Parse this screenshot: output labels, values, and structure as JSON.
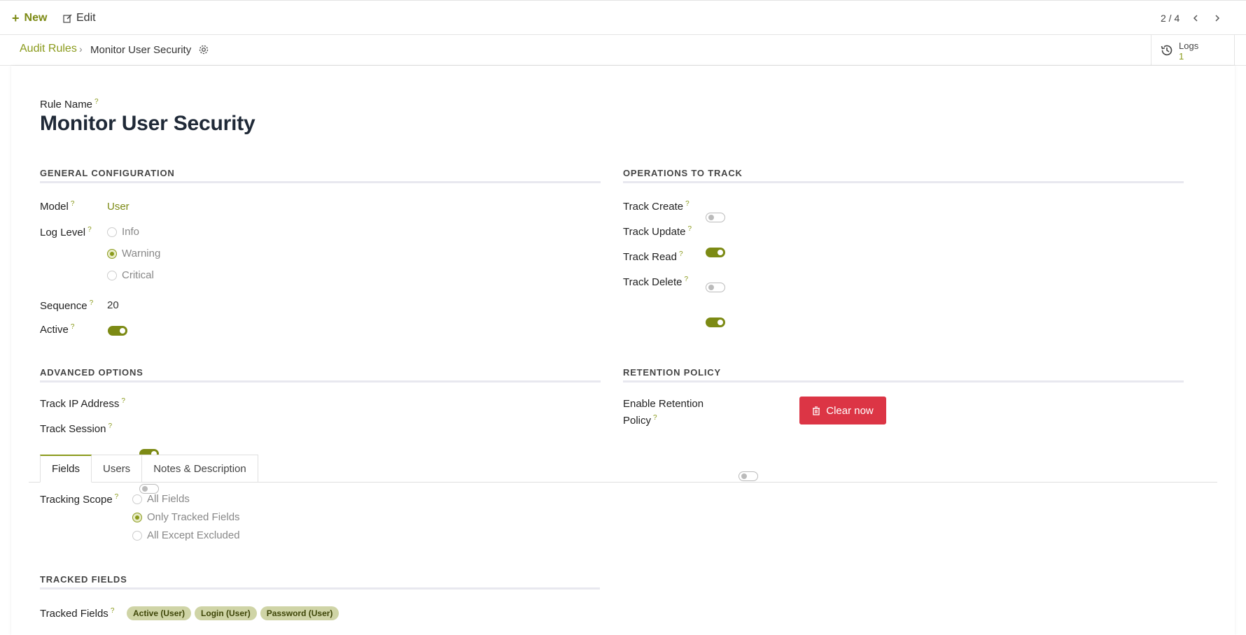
{
  "toolbar": {
    "new_label": "New",
    "edit_label": "Edit",
    "pager": "2 / 4"
  },
  "breadcrumb": {
    "parent": "Audit Rules",
    "current": "Monitor User Security"
  },
  "logs": {
    "label": "Logs",
    "count": "1"
  },
  "form": {
    "rule_name_label": "Rule Name",
    "rule_name": "Monitor User Security",
    "general": {
      "title": "GENERAL CONFIGURATION",
      "model_label": "Model",
      "model_value": "User",
      "log_level_label": "Log Level",
      "log_levels": [
        "Info",
        "Warning",
        "Critical"
      ],
      "log_level_selected": "Warning",
      "sequence_label": "Sequence",
      "sequence_value": "20",
      "active_label": "Active",
      "active": true
    },
    "operations": {
      "title": "OPERATIONS TO TRACK",
      "items": [
        {
          "label": "Track Create",
          "on": false
        },
        {
          "label": "Track Update",
          "on": true
        },
        {
          "label": "Track Read",
          "on": false
        },
        {
          "label": "Track Delete",
          "on": true
        }
      ]
    },
    "advanced": {
      "title": "ADVANCED OPTIONS",
      "items": [
        {
          "label": "Track IP Address",
          "on": true
        },
        {
          "label": "Track Session",
          "on": false
        }
      ]
    },
    "retention": {
      "title": "RETENTION POLICY",
      "enable_label_line1": "Enable Retention",
      "enable_label_line2": "Policy",
      "enabled": false,
      "clear_button": "Clear now"
    },
    "tabs": [
      "Fields",
      "Users",
      "Notes & Description"
    ],
    "active_tab": "Fields",
    "tracking_scope": {
      "label": "Tracking Scope",
      "options": [
        "All Fields",
        "Only Tracked Fields",
        "All Except Excluded"
      ],
      "selected": "Only Tracked Fields"
    },
    "tracked": {
      "title": "TRACKED FIELDS",
      "label": "Tracked Fields",
      "tags": [
        "Active (User)",
        "Login (User)",
        "Password (User)"
      ]
    }
  },
  "colors": {
    "accent": "#7c8a14",
    "danger": "#dc3545",
    "tag_bg": "#cfd4a6"
  },
  "help_mark": "?"
}
